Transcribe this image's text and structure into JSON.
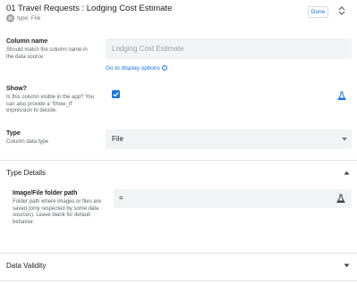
{
  "header": {
    "title": "01 Travel Requests : Lodging Cost Estimate",
    "subtitle": "type: File",
    "type_icon": "file-type-icon",
    "done_label": "Done",
    "nav_icon": "up-down-arrows-icon"
  },
  "column_name": {
    "label": "Column name",
    "description": "Should match the column name in the data source",
    "value": "Lodging Cost Estimate",
    "link_label": "Go to display options"
  },
  "show": {
    "label": "Show?",
    "description": "Is this column visible in the app? You can also provide a 'Show_If' expression to decide.",
    "checked": true
  },
  "type": {
    "label": "Type",
    "description": "Column data type",
    "value": "File"
  },
  "type_details": {
    "title": "Type Details",
    "expanded": true,
    "folder_path": {
      "label": "Image/File folder path",
      "description": "Folder path where images or files are saved (only respected by some data sources). Leave blank for default behavior.",
      "value": "="
    }
  },
  "data_validity": {
    "title": "Data Validity",
    "expanded": false
  },
  "colors": {
    "accent": "#1a73e8",
    "field_bg": "#f1f3f4"
  }
}
